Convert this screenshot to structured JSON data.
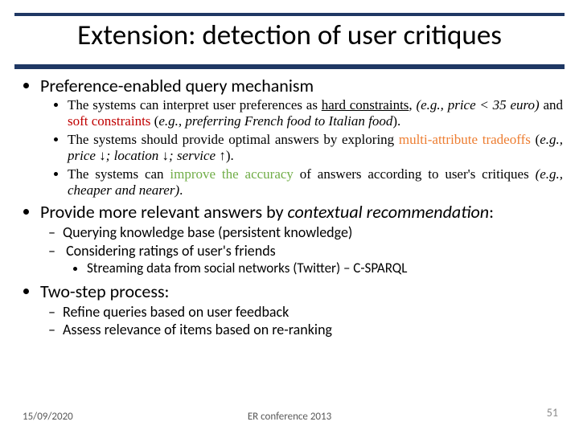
{
  "title": "Extension: detection of user critiques",
  "l1_1": "Preference-enabled query mechanism",
  "b1_a": "The systems can interpret user preferences as ",
  "b1_hard": "hard constraints",
  "b1_b": ", ",
  "b1_eg": "(e.g., price < 35 euro)",
  "b1_c": " and ",
  "b1_soft": " soft constraints",
  "b1_d": " (",
  "b1_eg2": "e.g., preferring French food to Italian food",
  "b1_e": ").",
  "b2_a": "The systems should provide optimal answers by exploring ",
  "b2_multi": "multi-attribute tradeoffs",
  "b2_b": " (",
  "b2_eg": "e.g., price ↓; location ↓; service ↑",
  "b2_c": ").",
  "b3_a": "The systems can ",
  "b3_imp": "improve the accuracy",
  "b3_b": " of answers according to user's critiques ",
  "b3_eg": "(e.g., cheaper and nearer)",
  "b3_c": ".",
  "l1_2a": "Provide more relevant answers by ",
  "l1_2b": "contextual recommendation",
  "l1_2c": ":",
  "d1": "Querying knowledge base (persistent knowledge)",
  "d2": "Considering ratings of user's friends",
  "d2_sub": "Streaming data from social networks (Twitter) – C-SPARQL",
  "l1_3": "Two-step process:",
  "d3": "Refine queries based on user feedback",
  "d4": "Assess relevance of items based on re-ranking",
  "footer": {
    "date": "15/09/2020",
    "center": "ER conference 2013",
    "page": "51"
  }
}
